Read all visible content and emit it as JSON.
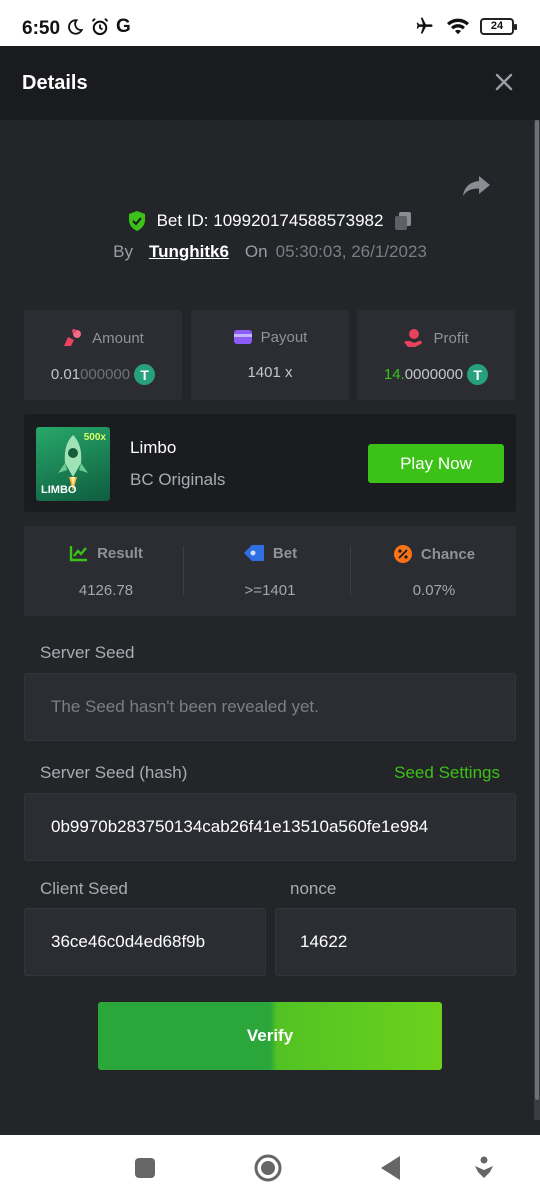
{
  "status_bar": {
    "time": "6:50",
    "g_label": "G",
    "battery": "24"
  },
  "header": {
    "title": "Details"
  },
  "bet": {
    "id_label": "Bet ID: 109920174588573982",
    "by_label": "By",
    "user": "Tunghitk6",
    "on_label": "On",
    "datetime": "05:30:03, 26/1/2023"
  },
  "stats": {
    "amount": {
      "label": "Amount",
      "value_main": "0.01",
      "value_faded": "000000"
    },
    "payout": {
      "label": "Payout",
      "value": "1401 x"
    },
    "profit": {
      "label": "Profit",
      "value_main": "14.",
      "value_faded": "0000000"
    }
  },
  "game": {
    "thumb_label": "LIMBO",
    "thumb_badge": "500x",
    "name": "Limbo",
    "provider": "BC Originals",
    "play_label": "Play Now"
  },
  "result": {
    "result_label": "Result",
    "result_value": "4126.78",
    "bet_label": "Bet",
    "bet_value": ">=1401",
    "chance_label": "Chance",
    "chance_value": "0.07%"
  },
  "server_seed": {
    "label": "Server Seed",
    "value": "The Seed hasn't been revealed yet."
  },
  "server_seed_hash": {
    "label": "Server Seed (hash)",
    "settings_label": "Seed Settings",
    "value": "0b9970b283750134cab26f41e13510a560fe1e984"
  },
  "client_seed": {
    "label": "Client Seed",
    "value": "36ce46c0d4ed68f9b"
  },
  "nonce": {
    "label": "nonce",
    "value": "14622"
  },
  "verify_label": "Verify",
  "colors": {
    "accent_green": "#3bc117",
    "background": "#232529",
    "card": "#2b2d32"
  }
}
